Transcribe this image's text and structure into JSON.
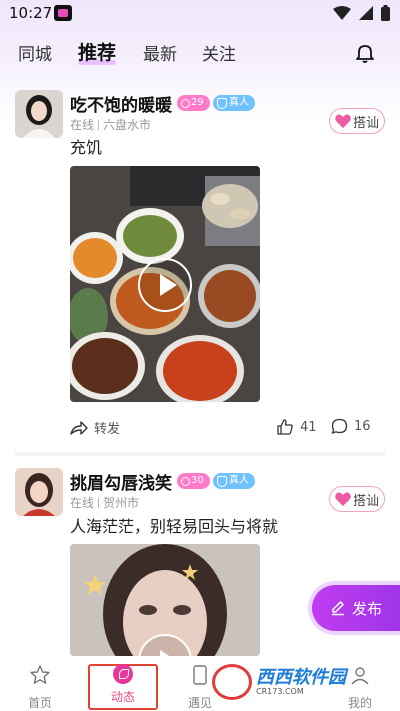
{
  "status_bar": {
    "time": "10:27"
  },
  "tabs": [
    {
      "label": "同城",
      "active": false
    },
    {
      "label": "推荐",
      "active": true
    },
    {
      "label": "最新",
      "active": false
    },
    {
      "label": "关注",
      "active": false
    }
  ],
  "posts": [
    {
      "username": "吃不饱的暖暖",
      "level": "29",
      "real_badge": "真人",
      "status": "在线",
      "location": "六盘水市",
      "chat_label": "搭讪",
      "text": "充饥",
      "share_label": "转发",
      "likes": "41",
      "comments": "16"
    },
    {
      "username": "挑眉勾唇浅笑",
      "level": "30",
      "real_badge": "真人",
      "status": "在线",
      "location": "贺州市",
      "chat_label": "搭讪",
      "text": "人海茫茫，别轻易回头与将就"
    }
  ],
  "publish_label": "发布",
  "bottom_nav": [
    {
      "label": "首页",
      "icon": "star-icon"
    },
    {
      "label": "动态",
      "icon": "moments-icon",
      "active": true
    },
    {
      "label": "遇见",
      "icon": "phone-icon"
    },
    {
      "label": "我的",
      "icon": "profile-icon"
    }
  ],
  "watermark": {
    "title": "西西软件园",
    "url": "CR173.COM"
  },
  "colors": {
    "accent": "#e8379c",
    "publish": "#b53aee",
    "level_badge": "#ff7ac8",
    "real_badge": "#6fc2ff"
  }
}
